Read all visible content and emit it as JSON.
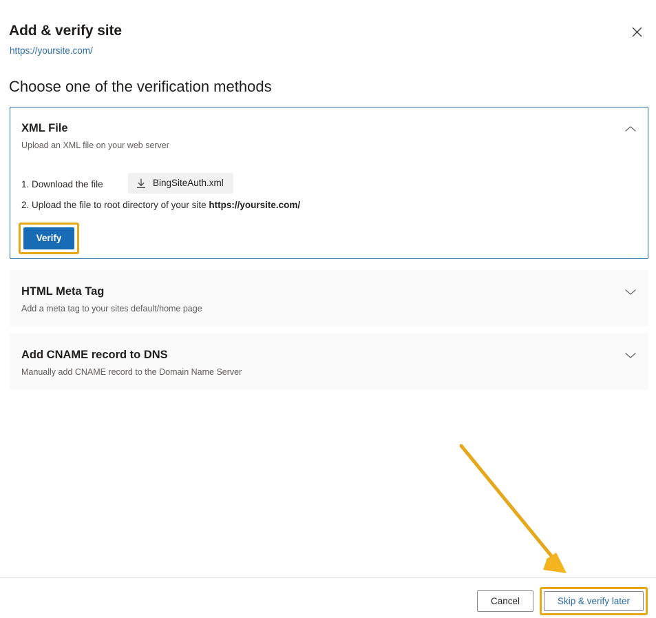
{
  "dialog": {
    "title": "Add & verify site",
    "site_url": "https://yoursite.com/",
    "close_icon": "close-icon",
    "section_heading": "Choose one of the verification methods"
  },
  "methods": [
    {
      "id": "xml-file",
      "title": "XML File",
      "subtitle": "Upload an XML file on your web server",
      "expanded": true,
      "chevron_icon": "chevron-up-icon",
      "steps": {
        "step1_label": "1. Download the file",
        "file_chip_label": "BingSiteAuth.xml",
        "file_chip_icon": "download-icon",
        "step2_prefix": "2. Upload the file to root directory of your site ",
        "step2_url": "https://yoursite.com/"
      },
      "verify_button": "Verify"
    },
    {
      "id": "html-meta-tag",
      "title": "HTML Meta Tag",
      "subtitle": "Add a meta tag to your sites default/home page",
      "expanded": false,
      "chevron_icon": "chevron-down-icon"
    },
    {
      "id": "cname-dns",
      "title": "Add CNAME record to DNS",
      "subtitle": "Manually add CNAME record to the Domain Name Server",
      "expanded": false,
      "chevron_icon": "chevron-down-icon"
    }
  ],
  "footer": {
    "cancel_label": "Cancel",
    "skip_label": "Skip & verify later"
  },
  "annotations": {
    "arrow_icon": "arrow-pointer-icon",
    "highlight_color": "#e6a817",
    "arrow_color": "#e5a81c"
  },
  "colors": {
    "primary_button": "#186cb5",
    "link": "#2b6ca3",
    "card_border_active": "#2b6ca3",
    "card_background_collapsed": "#fafafa",
    "chip_background": "#f1f1f1"
  }
}
